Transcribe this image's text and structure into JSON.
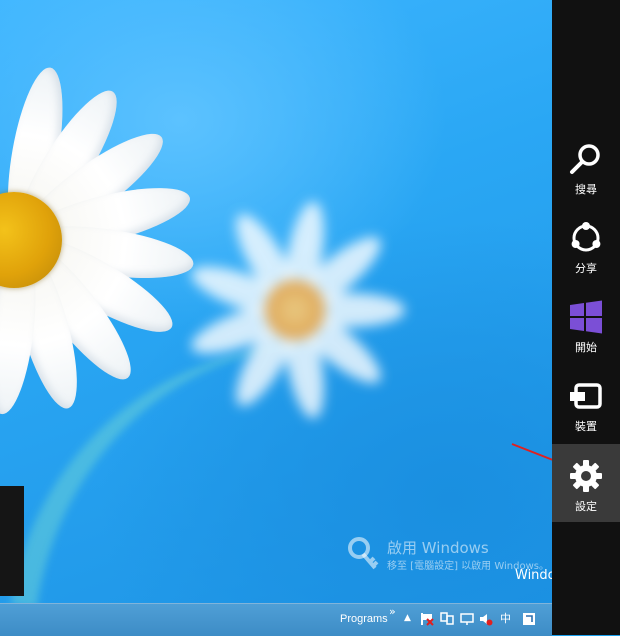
{
  "charms": [
    {
      "label": "搜尋",
      "icon": "search-icon"
    },
    {
      "label": "分享",
      "icon": "share-icon"
    },
    {
      "label": "開始",
      "icon": "windows-logo-icon"
    },
    {
      "label": "裝置",
      "icon": "devices-icon"
    },
    {
      "label": "設定",
      "icon": "settings-gear-icon",
      "active": true
    }
  ],
  "watermark": {
    "title": "啟用 Windows",
    "subtitle": "移至 [電腦設定] 以啟用 Windows。",
    "windows_text": "Windo"
  },
  "taskbar": {
    "programs_label": "Programs",
    "chevron": "»",
    "up_arrow": "▲",
    "ime_label": "中"
  },
  "colors": {
    "charms_bg": "#111111",
    "charm_active_bg": "#3a3a3a",
    "windows_logo": "#7b4fd6",
    "annotation_arrow": "#e02020"
  }
}
